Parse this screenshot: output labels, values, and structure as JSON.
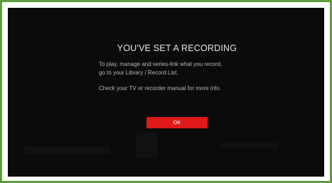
{
  "dialog": {
    "title": "YOU'VE SET A RECORDING",
    "line1": "To play, manage and series-link what you record,",
    "line2": "go to your Library / Record List.",
    "line3": "Check your TV or recorder manual for more info.",
    "ok_label": "OK"
  },
  "colors": {
    "frame_border": "#5c9c3c",
    "screen_bg": "#0b0b0b",
    "ok_button_bg": "#e01919",
    "title_text": "#e6e6e6",
    "body_text": "#b7b7b7"
  }
}
